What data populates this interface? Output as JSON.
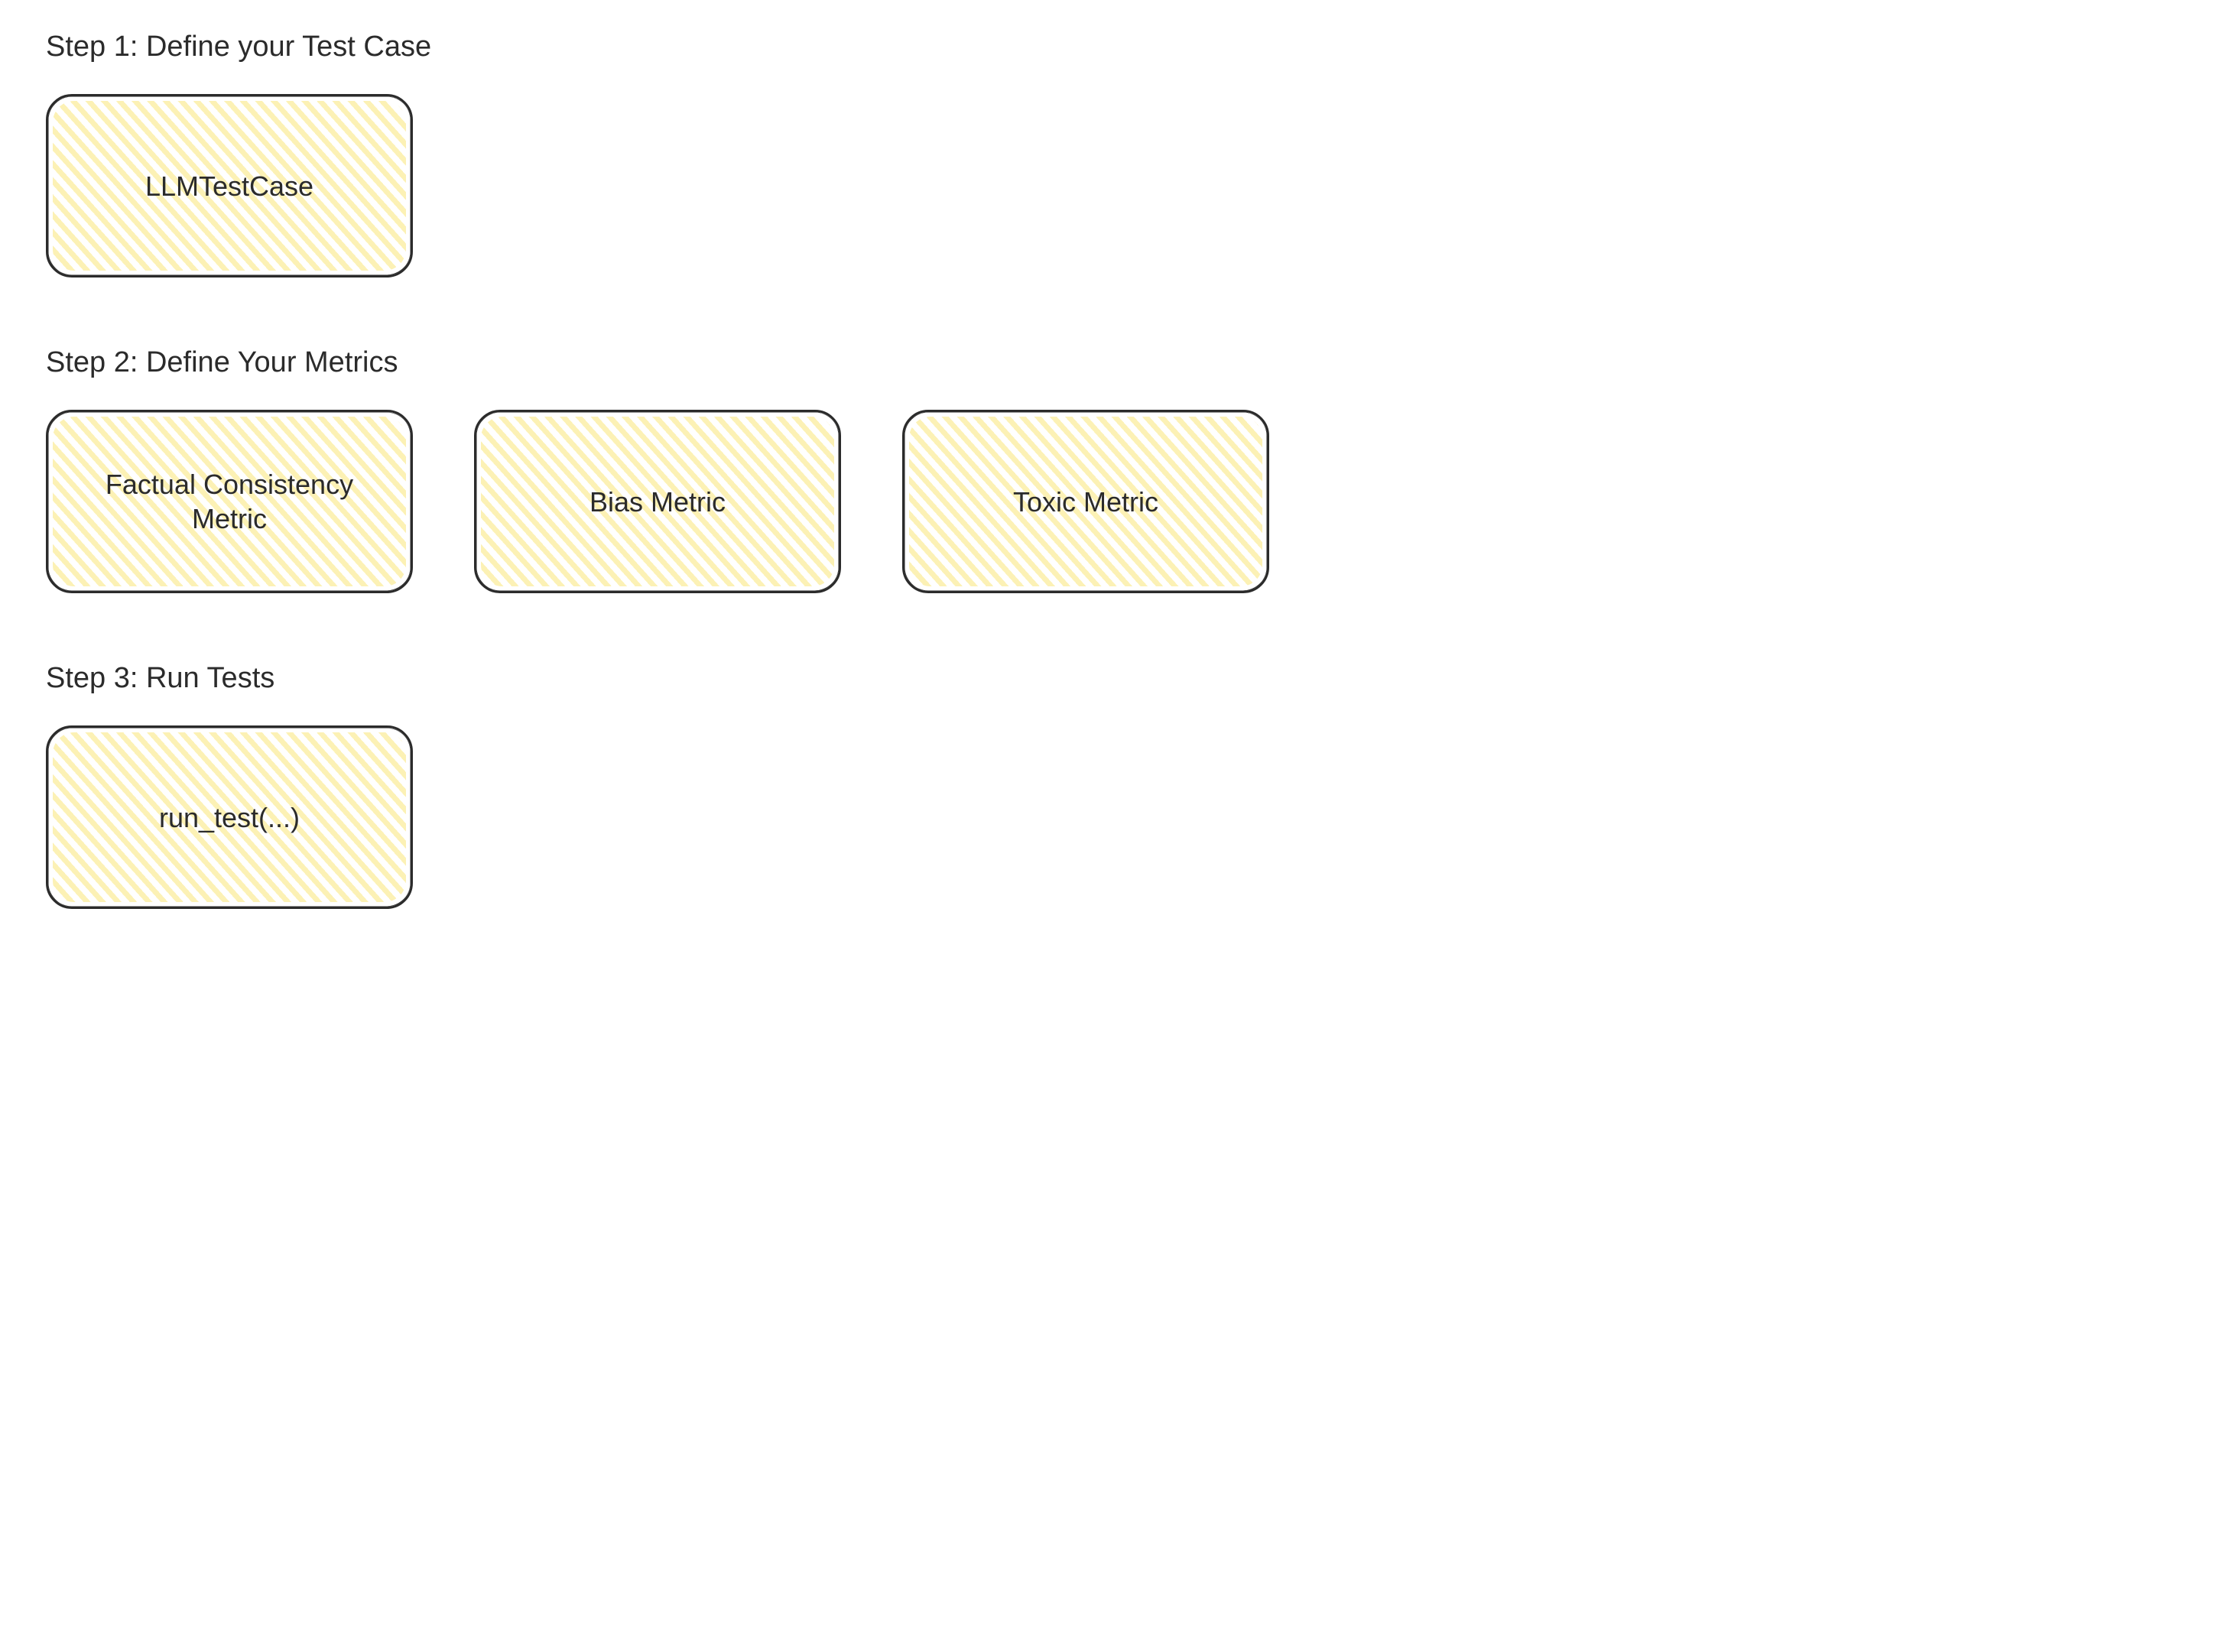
{
  "steps": [
    {
      "heading": "Step 1: Define your Test Case",
      "boxes": [
        "LLMTestCase"
      ]
    },
    {
      "heading": "Step 2: Define Your Metrics",
      "boxes": [
        "Factual Consistency Metric",
        "Bias Metric",
        "Toxic Metric"
      ]
    },
    {
      "heading": "Step 3: Run Tests",
      "boxes": [
        "run_test(...)"
      ]
    }
  ],
  "style": {
    "box_fill": "#fae678",
    "box_stroke": "#2b2b2b"
  }
}
